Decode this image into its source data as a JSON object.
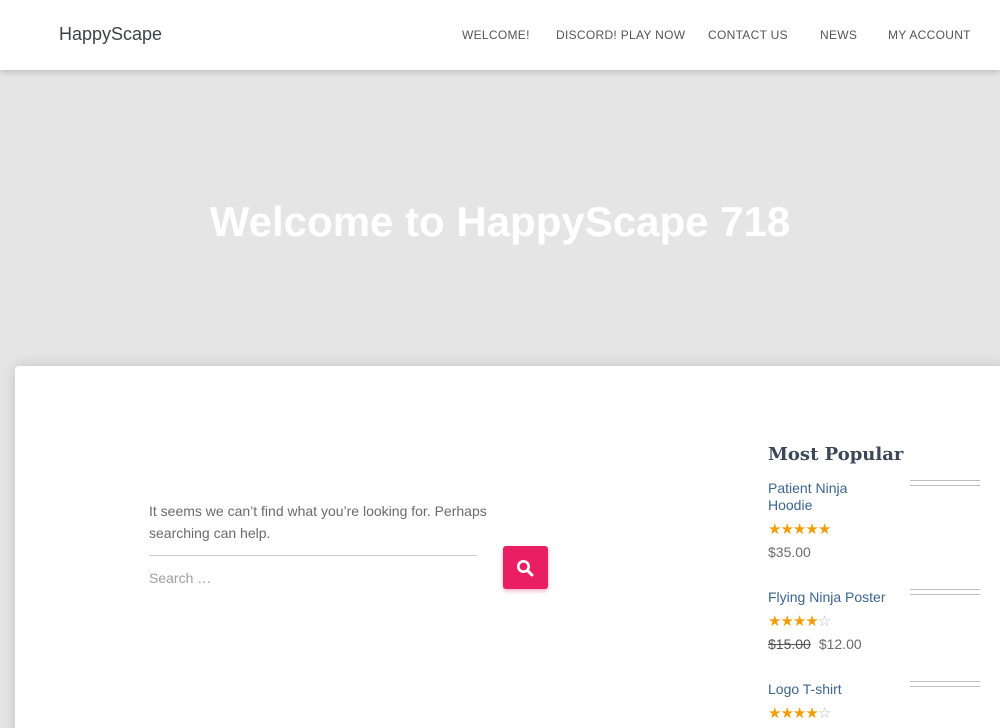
{
  "header": {
    "brand": "HappyScape",
    "nav": [
      {
        "label": "WELCOME!"
      },
      {
        "label": "DISCORD! PLAY NOW"
      },
      {
        "label": "CONTACT US"
      },
      {
        "label": "NEWS"
      },
      {
        "label": "MY ACCOUNT"
      }
    ]
  },
  "hero": {
    "title": "Welcome to HappyScape 718"
  },
  "content": {
    "message": "It seems we can’t find what you’re looking for. Perhaps searching can help.",
    "search": {
      "placeholder": "Search …",
      "value": "",
      "button_icon": "search-icon"
    }
  },
  "sidebar": {
    "title": "Most Popular",
    "products": [
      {
        "name": "Patient Ninja Hoodie",
        "rating": 5,
        "price": "$35.00",
        "old_price": ""
      },
      {
        "name": "Flying Ninja Poster",
        "rating": 4,
        "price": "$12.00",
        "old_price": "$15.00"
      },
      {
        "name": "Logo T-shirt",
        "rating": 4,
        "price": "",
        "old_price": ""
      }
    ]
  },
  "colors": {
    "accent": "#e91e63",
    "star": "#f19d09",
    "link": "#3c6590",
    "hero_bg": "#e5e5e5"
  }
}
